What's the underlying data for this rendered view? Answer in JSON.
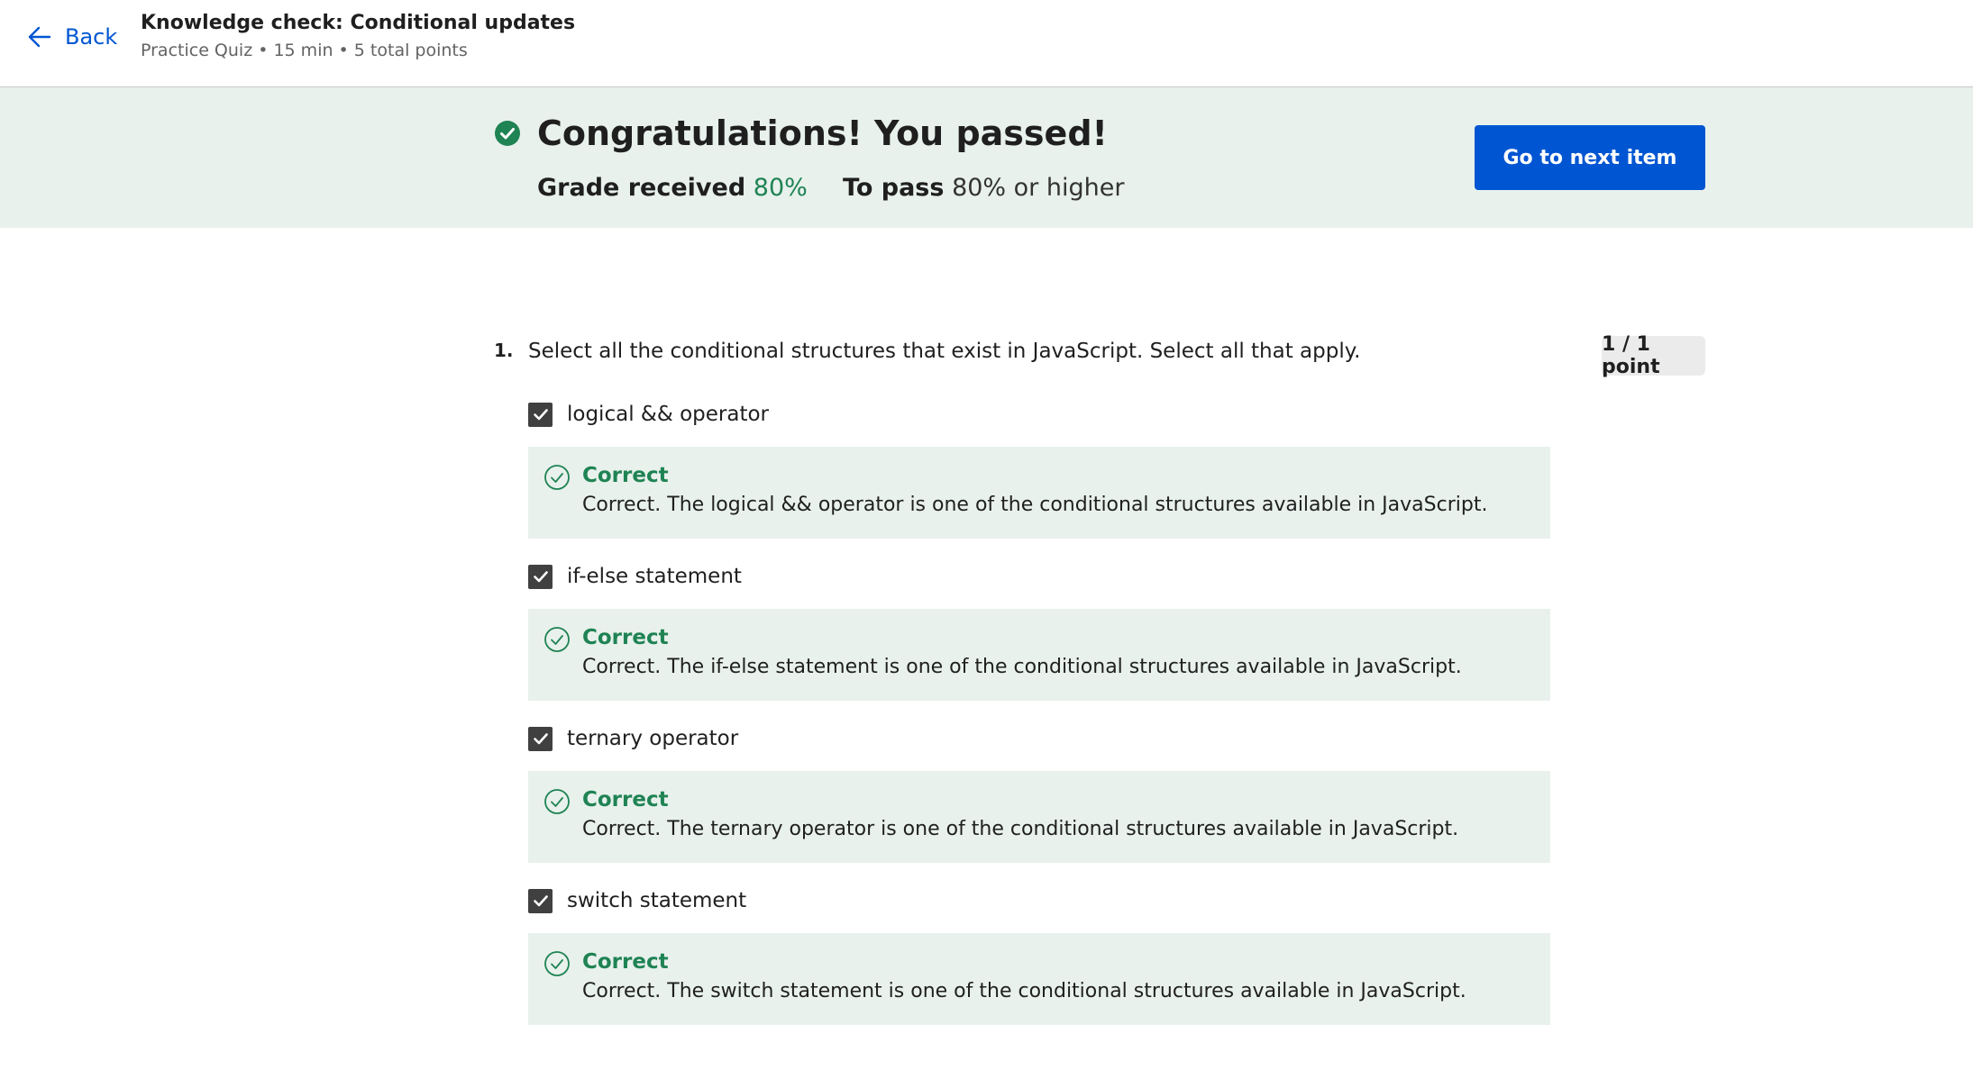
{
  "header": {
    "back_label": "Back",
    "title": "Knowledge check: Conditional updates",
    "meta": "Practice Quiz • 15 min • 5 total points"
  },
  "result": {
    "headline": "Congratulations! You passed!",
    "grade_label": "Grade received",
    "grade_value": "80%",
    "pass_label": "To pass",
    "pass_value": "80% or higher",
    "next_button": "Go to next item"
  },
  "question": {
    "number": "1.",
    "text": "Select all the conditional structures that exist in JavaScript. Select all that apply.",
    "points": "1 / 1 point",
    "options": [
      {
        "label": "logical && operator",
        "checked": true,
        "feedback_title": "Correct",
        "feedback_text": "Correct. The logical && operator is one of the conditional structures available in JavaScript."
      },
      {
        "label": "if-else statement",
        "checked": true,
        "feedback_title": "Correct",
        "feedback_text": "Correct. The if-else statement is one of the conditional structures available in JavaScript."
      },
      {
        "label": "ternary operator",
        "checked": true,
        "feedback_title": "Correct",
        "feedback_text": "Correct. The ternary operator is one of the conditional structures available in JavaScript."
      },
      {
        "label": "switch statement",
        "checked": true,
        "feedback_title": "Correct",
        "feedback_text": "Correct. The switch statement is one of the conditional structures available in JavaScript."
      }
    ]
  },
  "colors": {
    "accent_blue": "#0056d2",
    "success_green": "#1f8354",
    "success_bg": "#e8f1ec"
  }
}
